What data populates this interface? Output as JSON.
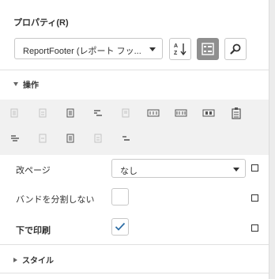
{
  "panel": {
    "title": "プロパティ(R)",
    "selector_value": "ReportFooter (レポート フッ..."
  },
  "toolbar": {
    "sort_icon": "sort-alpha-icon",
    "categorized_icon": "categorized-icon",
    "search_icon": "search-icon"
  },
  "sections": {
    "operations": "操作",
    "style": "スタイル"
  },
  "properties": {
    "page_break_label": "改ページ",
    "page_break_value": "なし",
    "keep_together_label": "バンドを分割しない",
    "keep_together_checked": false,
    "print_at_bottom_label": "下で印刷",
    "print_at_bottom_checked": true
  },
  "colors": {
    "accent": "#2e6ea6",
    "active_button": "#8f8f8f",
    "icon_area_bg": "#f1f1f1"
  }
}
